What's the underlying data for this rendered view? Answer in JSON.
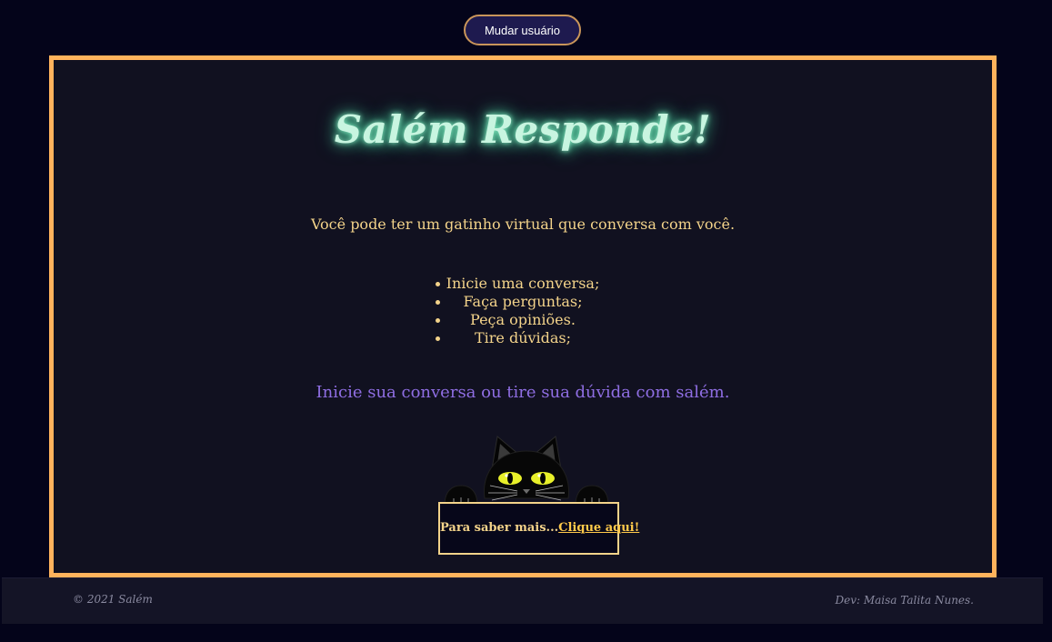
{
  "header": {
    "switch_user_label": "Mudar usuário"
  },
  "main": {
    "title": "Salém Responde!",
    "intro": "Você pode ter um gatinho virtual que conversa com você.",
    "features": [
      "Inicie uma conversa;",
      "Faça perguntas;",
      "Peça opiniões.",
      "Tire dúvidas;"
    ],
    "cta": "Inicie sua conversa ou tire sua dúvida com salém.",
    "more_prefix": "Para saber mais...",
    "more_link": "Clique aqui!"
  },
  "footer": {
    "copyright": "© 2021 Salém",
    "dev": "Dev: Maisa Talita Nunes."
  },
  "colors": {
    "background": "#04041a",
    "card_border": "#ffb35c",
    "card_background": "#111120",
    "title_glow": "#8ff0c8",
    "text": "#f3d38a",
    "cta": "#8f6ee3",
    "button_background": "#1e1a4f",
    "button_border": "#c9955a"
  },
  "icons": {
    "mascot": "black-cat-peeking-icon"
  }
}
